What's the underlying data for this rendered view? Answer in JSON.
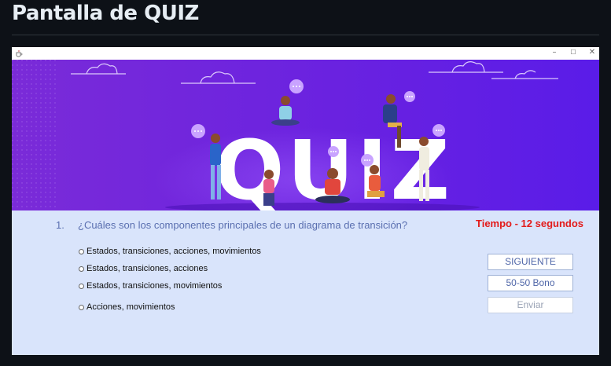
{
  "page": {
    "title": "Pantalla de QUIZ"
  },
  "window": {
    "icon": "java-cup-icon",
    "controls": {
      "minimize": "–",
      "maximize": "☐",
      "close": "✕"
    }
  },
  "banner": {
    "word": "QUIZ"
  },
  "question": {
    "number": "1.",
    "text": "¿Cuáles son los componentes principales de un diagrama de transición?",
    "timer": "Tiempo - 12 segundos",
    "options": [
      "Estados, transiciones, acciones, movimientos",
      "Estados, transiciones, acciones",
      "Estados, transiciones, movimientos",
      "Acciones, movimientos"
    ]
  },
  "buttons": {
    "next": "SIGUIENTE",
    "fifty": "50-50 Bono",
    "submit": "Enviar"
  },
  "colors": {
    "banner_start": "#7a2bd8",
    "banner_end": "#5a1ce8",
    "panel": "#d9e4fb",
    "timer": "#e31b1b",
    "question": "#5a6fb0"
  }
}
